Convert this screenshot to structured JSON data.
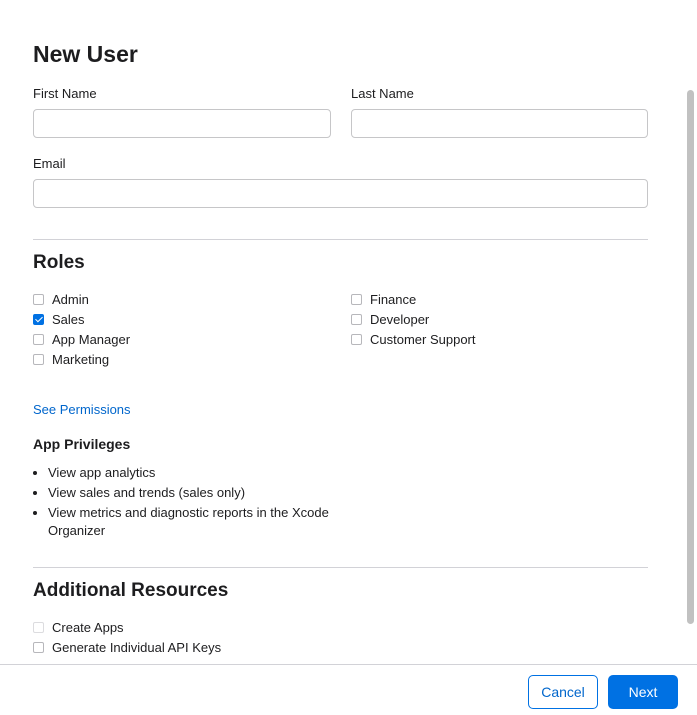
{
  "dialog": {
    "title": "New User"
  },
  "form": {
    "first_name": {
      "label": "First Name",
      "value": "",
      "placeholder": ""
    },
    "last_name": {
      "label": "Last Name",
      "value": "",
      "placeholder": ""
    },
    "email": {
      "label": "Email",
      "value": "",
      "placeholder": ""
    }
  },
  "roles": {
    "heading": "Roles",
    "items": [
      {
        "label": "Admin",
        "checked": false
      },
      {
        "label": "Sales",
        "checked": true
      },
      {
        "label": "App Manager",
        "checked": false
      },
      {
        "label": "Marketing",
        "checked": false
      },
      {
        "label": "Finance",
        "checked": false
      },
      {
        "label": "Developer",
        "checked": false
      },
      {
        "label": "Customer Support",
        "checked": false
      }
    ],
    "see_permissions_link": "See Permissions"
  },
  "app_privileges": {
    "heading": "App Privileges",
    "items": [
      "View app analytics",
      "View sales and trends (sales only)",
      "View metrics and diagnostic reports in the Xcode Organizer"
    ]
  },
  "additional_resources": {
    "heading": "Additional Resources",
    "items": [
      {
        "label": "Create Apps",
        "checked": false,
        "disabled": true
      },
      {
        "label": "Generate Individual API Keys",
        "checked": false,
        "disabled": false
      }
    ]
  },
  "footer": {
    "cancel_label": "Cancel",
    "next_label": "Next"
  },
  "colors": {
    "accent": "#0071e3",
    "link": "#0066cc",
    "divider": "#d2d2d7"
  }
}
